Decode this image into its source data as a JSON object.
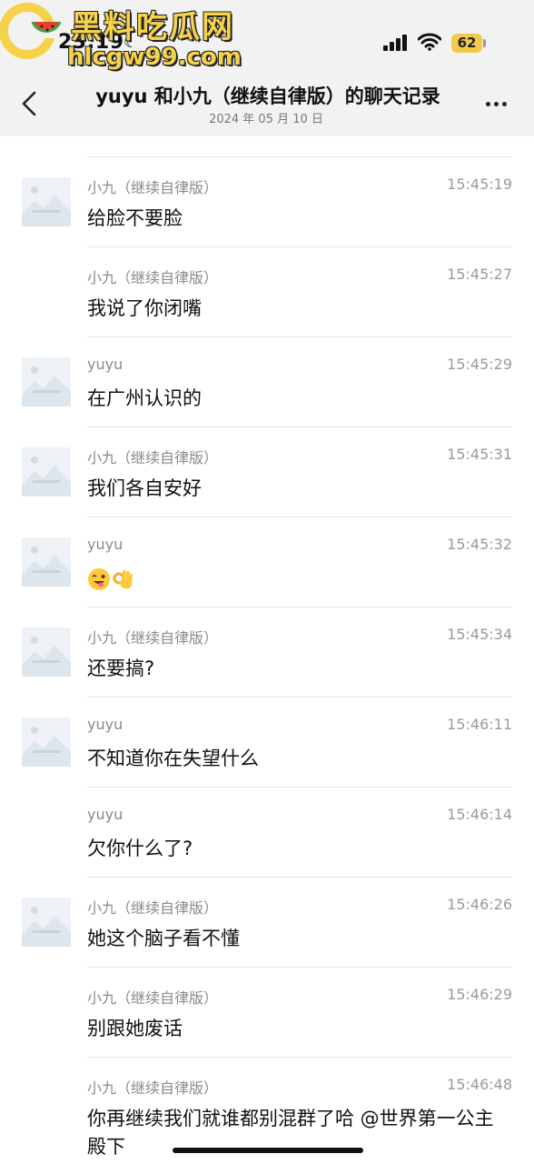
{
  "status_bar": {
    "time": "23:19",
    "battery": "62"
  },
  "watermark": {
    "title": "黑料吃瓜网",
    "url": "hlcgw99.com"
  },
  "header": {
    "title": "yuyu 和小九（继续自律版）的聊天记录",
    "subtitle": "2024 年 05 月 10 日"
  },
  "messages": [
    {
      "sender": "小九（继续自律版）",
      "time": "15:45:19",
      "text": "给脸不要脸",
      "avatar": true
    },
    {
      "sender": "小九（继续自律版）",
      "time": "15:45:27",
      "text": "我说了你闭嘴",
      "avatar": false
    },
    {
      "sender": "yuyu",
      "time": "15:45:29",
      "text": "在广州认识的",
      "avatar": true
    },
    {
      "sender": "小九（继续自律版）",
      "time": "15:45:31",
      "text": "我们各自安好",
      "avatar": true
    },
    {
      "sender": "yuyu",
      "time": "15:45:32",
      "text": "",
      "emojis": [
        "wink-tongue-emoji",
        "ok-hand-emoji"
      ],
      "avatar": true
    },
    {
      "sender": "小九（继续自律版）",
      "time": "15:45:34",
      "text": "还要搞?",
      "avatar": true
    },
    {
      "sender": "yuyu",
      "time": "15:46:11",
      "text": "不知道你在失望什么",
      "avatar": true
    },
    {
      "sender": "yuyu",
      "time": "15:46:14",
      "text": "欠你什么了?",
      "avatar": false
    },
    {
      "sender": "小九（继续自律版）",
      "time": "15:46:26",
      "text": "她这个脑子看不懂",
      "avatar": true
    },
    {
      "sender": "小九（继续自律版）",
      "time": "15:46:29",
      "text": "别跟她废话",
      "avatar": false
    },
    {
      "sender": "小九（继续自律版）",
      "time": "15:46:48",
      "text": "你再继续我们就谁都别混群了哈 @世界第一公主殿下",
      "avatar": false
    }
  ],
  "colors": {
    "header_bg": "#f2f2f2",
    "watermark": "#f6d24a",
    "battery": "#f3c94a"
  }
}
